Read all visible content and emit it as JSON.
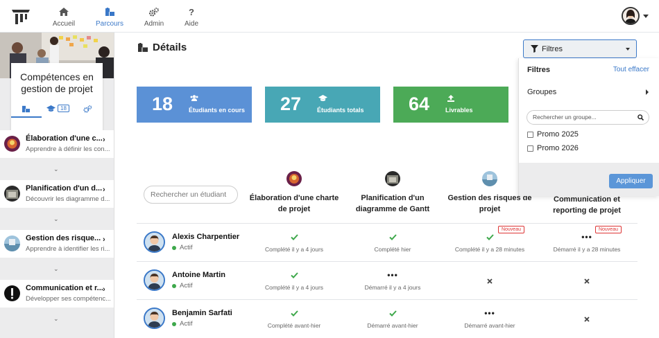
{
  "topbar": {
    "nav": [
      {
        "label": "Accueil",
        "icon": "home-icon"
      },
      {
        "label": "Parcours",
        "icon": "puzzle-icon"
      },
      {
        "label": "Admin",
        "icon": "gears-icon"
      },
      {
        "label": "Aide",
        "icon": "question-icon"
      }
    ],
    "active": "Parcours"
  },
  "sidebar": {
    "course_title": "Compétences en gestion de projet",
    "tab_count": "18",
    "modules": [
      {
        "title": "Élaboration d'une c...",
        "subtitle": "Apprendre à définir les con..."
      },
      {
        "title": "Planification d'un d...",
        "subtitle": "Découvrir les diagramme d..."
      },
      {
        "title": "Gestion des risque...",
        "subtitle": "Apprendre à identifier les ri..."
      },
      {
        "title": "Communication et r...",
        "subtitle": "Développer ses compétenc..."
      }
    ]
  },
  "main": {
    "page_title": "Détails",
    "filter_button": "Filtres",
    "stats": [
      {
        "value": "18",
        "label": "Étudiants en cours",
        "color": "#5b91d6"
      },
      {
        "value": "27",
        "label": "Étudiants totals",
        "color": "#48a7b5"
      },
      {
        "value": "64",
        "label": "Livrables",
        "color": "#4caa57"
      }
    ],
    "search_placeholder": "Rechercher un étudiant",
    "columns": [
      "Élaboration d'une charte de projet",
      "Planification d'un diagramme de Gantt",
      "Gestion des risques de projet",
      "Communication et reporting de projet"
    ],
    "badge_label": "Nouveau",
    "students": [
      {
        "name": "Alexis Charpentier",
        "status": "Actif",
        "cells": [
          {
            "mark": "check",
            "text": "Complété il y a 4 jours"
          },
          {
            "mark": "check",
            "text": "Complété hier"
          },
          {
            "mark": "check",
            "text": "Complété il y a 28 minutes",
            "badge": true
          },
          {
            "mark": "dots",
            "text": "Démarré il y a 28 minutes",
            "badge": true
          }
        ]
      },
      {
        "name": "Antoine Martin",
        "status": "Actif",
        "cells": [
          {
            "mark": "check",
            "text": "Complété il y a 4 jours"
          },
          {
            "mark": "dots",
            "text": "Démarré il y a 4 jours"
          },
          {
            "mark": "cross",
            "text": ""
          },
          {
            "mark": "cross",
            "text": ""
          }
        ]
      },
      {
        "name": "Benjamin Sarfati",
        "status": "Actif",
        "cells": [
          {
            "mark": "check",
            "text": "Complété avant-hier"
          },
          {
            "mark": "check",
            "text": "Démarré avant-hier"
          },
          {
            "mark": "dots",
            "text": "Démarré avant-hier"
          },
          {
            "mark": "cross",
            "text": ""
          }
        ]
      }
    ]
  },
  "filter_panel": {
    "heading": "Filtres",
    "clear_label": "Tout effacer",
    "groups_label": "Groupes",
    "group_search_placeholder": "Rechercher un groupe...",
    "options": [
      "Promo 2025",
      "Promo 2026"
    ],
    "apply_label": "Appliquer"
  },
  "colors": {
    "accent": "#3a78c8",
    "check": "#3ea84b",
    "badge": "#dd3333"
  }
}
